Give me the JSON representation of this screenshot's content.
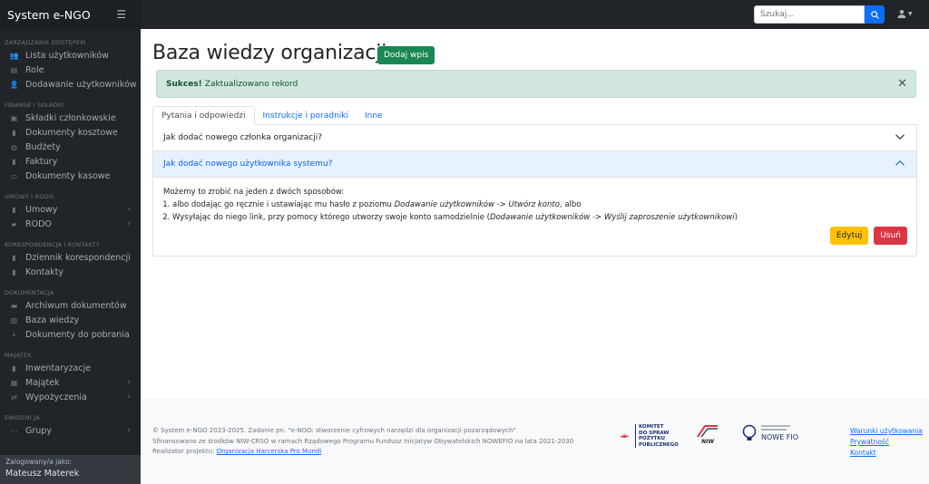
{
  "app": {
    "brand": "System e-NGO"
  },
  "search": {
    "placeholder": "Szukaj..."
  },
  "sidebar": {
    "sections": [
      {
        "heading": "ZARZĄDZANIE DOSTĘPEM",
        "items": [
          {
            "label": "Lista użytkowników",
            "icon": "users-icon",
            "chevron": false
          },
          {
            "label": "Role",
            "icon": "id-card-icon",
            "chevron": false
          },
          {
            "label": "Dodawanie użytkowników",
            "icon": "user-plus-icon",
            "chevron": true
          }
        ]
      },
      {
        "heading": "FINANSE I SKŁADKI",
        "items": [
          {
            "label": "Składki członkowskie",
            "icon": "wallet-icon",
            "chevron": false
          },
          {
            "label": "Dokumenty kosztowe",
            "icon": "file-icon",
            "chevron": false
          },
          {
            "label": "Budżety",
            "icon": "piggy-bank-icon",
            "chevron": false
          },
          {
            "label": "Faktury",
            "icon": "file-icon",
            "chevron": false
          },
          {
            "label": "Dokumenty kasowe",
            "icon": "money-icon",
            "chevron": false
          }
        ]
      },
      {
        "heading": "UMOWY I RODO",
        "items": [
          {
            "label": "Umowy",
            "icon": "file-contract-icon",
            "chevron": true
          },
          {
            "label": "RODO",
            "icon": "folder-icon",
            "chevron": true
          }
        ]
      },
      {
        "heading": "KORESPONDENCJA I KONTAKTY",
        "items": [
          {
            "label": "Dziennik korespondencji",
            "icon": "book-icon",
            "chevron": false
          },
          {
            "label": "Kontakty",
            "icon": "address-book-icon",
            "chevron": false
          }
        ]
      },
      {
        "heading": "DOKUMENTACJA",
        "items": [
          {
            "label": "Archiwum dokumentów",
            "icon": "archive-icon",
            "chevron": false
          },
          {
            "label": "Baza wiedzy",
            "icon": "book-open-icon",
            "chevron": false
          },
          {
            "label": "Dokumenty do pobrania",
            "icon": "download-icon",
            "chevron": false
          }
        ]
      },
      {
        "heading": "MAJĄTEK",
        "items": [
          {
            "label": "Inwentaryzacje",
            "icon": "clipboard-icon",
            "chevron": false
          },
          {
            "label": "Majątek",
            "icon": "boxes-icon",
            "chevron": true
          },
          {
            "label": "Wypożyczenia",
            "icon": "handshake-icon",
            "chevron": true
          }
        ]
      },
      {
        "heading": "EWIDENCJA",
        "items": [
          {
            "label": "Grupy",
            "icon": "sitemap-icon",
            "chevron": true
          }
        ]
      }
    ],
    "footer": {
      "logged_as": "Zalogowany/a jako:",
      "user_name": "Mateusz Materek"
    }
  },
  "main": {
    "title": "Baza wiedzy organizacji",
    "add_button": "Dodaj wpis",
    "alert": {
      "strong": "Sukces!",
      "text": "Zaktualizowano rekord"
    },
    "tabs": [
      {
        "label": "Pytania i odpowiedzi",
        "active": true
      },
      {
        "label": "Instrukcje i poradniki",
        "active": false
      },
      {
        "label": "Inne",
        "active": false
      }
    ],
    "accordion": [
      {
        "question": "Jak dodać nowego członka organizacji?",
        "open": false
      },
      {
        "question": "Jak dodać nowego użytkownika systemu?",
        "open": true
      }
    ],
    "answer": {
      "intro": "Możemy to zrobić na jeden z dwóch sposobów:",
      "item1_prefix": "albo dodając go ręcznie i ustawiając mu hasło z poziomu ",
      "item1_em": "Dodawanie użytkowników -> Utwórz konto",
      "item1_suffix": ", albo",
      "item2_prefix": "Wysyłając do niego link, przy pomocy którego utworzy swoje konto samodzielnie (",
      "item2_em": "Dodawanie użytkowników -> Wyślij zaproszenie użytkownikowi",
      "item2_suffix": ")"
    },
    "edit_button": "Edytuj",
    "delete_button": "Usuń"
  },
  "footer": {
    "line1": "© System e-NGO 2023-2025. Zadanie pn. \"e-NGO: stworzenie cyfrowych narzędzi dla organizacji pozarządowych\"",
    "line2": "Sfinansowano ze środków NIW-CRSO w ramach Rządowego Programu Fundusz Inicjatyw Obywatelskich NOWEFIO na lata 2021-2030",
    "line3_prefix": "Realizator projektu: ",
    "line3_link": "Organizacja Harcerska Pro Mundi",
    "logos": {
      "kdspp": [
        "KOMITET",
        "DO SPRAW",
        "POŻYTKU",
        "PUBLICZNEGO"
      ],
      "niw": "NIW",
      "fio": "NOWE FIO"
    },
    "links": [
      "Warunki użytkowania",
      "Prywatność",
      "Kontakt"
    ]
  }
}
